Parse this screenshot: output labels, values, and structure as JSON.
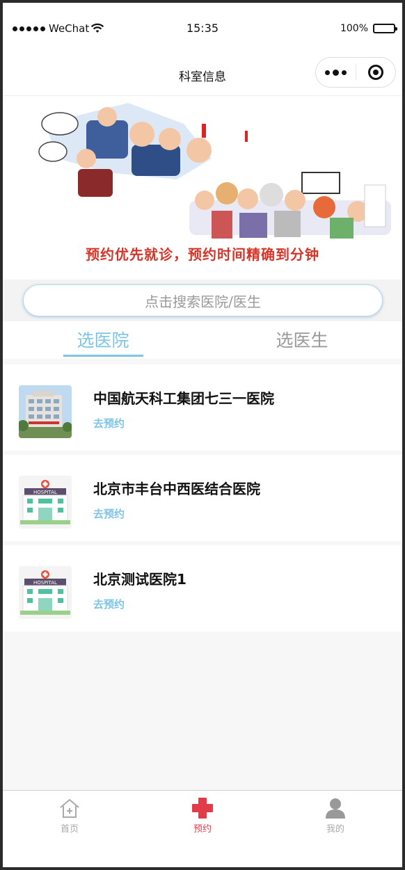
{
  "status_bar": {
    "carrier": "WeChat",
    "time": "15:35",
    "battery": "100%",
    "battery_level": 1.0
  },
  "nav": {
    "title": "科室信息"
  },
  "banner": {
    "caption": "预约优先就诊，预约时间精确到分钟"
  },
  "search": {
    "placeholder": "点击搜索医院/医生"
  },
  "tabs": [
    {
      "label": "选医院",
      "active": true
    },
    {
      "label": "选医生",
      "active": false
    }
  ],
  "hospitals": [
    {
      "name": "中国航天科工集团七三一医院",
      "action": "去预约",
      "image": "hospital-building-photo"
    },
    {
      "name": "北京市丰台中西医结合医院",
      "action": "去预约",
      "image": "hospital-illustration",
      "sign": "HOSPITAL"
    },
    {
      "name": "北京测试医院1",
      "action": "去预约",
      "image": "hospital-illustration",
      "sign": "HOSPITAL"
    }
  ],
  "tab_bar": [
    {
      "label": "首页",
      "icon": "home-icon",
      "active": false
    },
    {
      "label": "预约",
      "icon": "red-cross-icon",
      "active": true
    },
    {
      "label": "我的",
      "icon": "user-icon",
      "active": false
    }
  ],
  "colors": {
    "accent": "#7dc4e6",
    "active_tab": "#e23b4a",
    "banner_text": "#d6352a"
  }
}
